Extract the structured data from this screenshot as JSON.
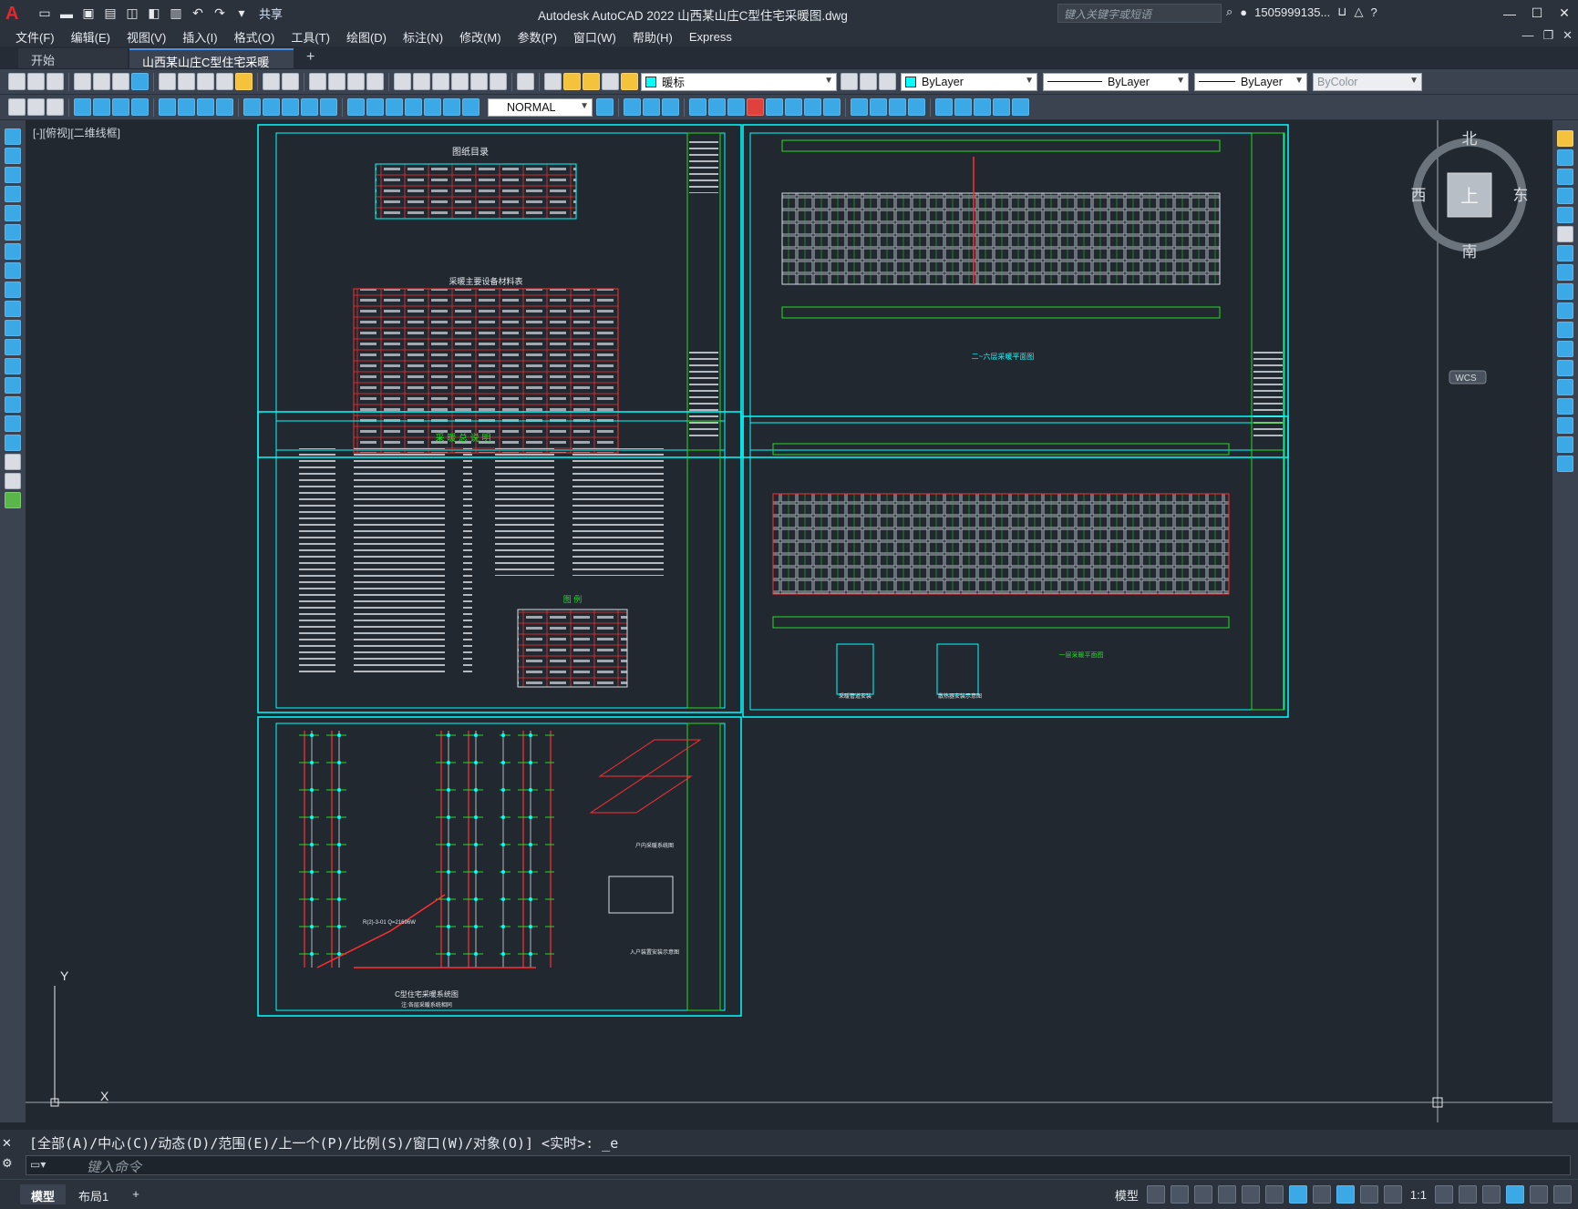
{
  "app": {
    "title": "Autodesk AutoCAD 2022    山西某山庄C型住宅采暖图.dwg",
    "share": "共享",
    "search_placeholder": "键入关键字或短语",
    "user": "1505999135...",
    "logo": "A"
  },
  "menu": [
    "文件(F)",
    "编辑(E)",
    "视图(V)",
    "插入(I)",
    "格式(O)",
    "工具(T)",
    "绘图(D)",
    "标注(N)",
    "修改(M)",
    "参数(P)",
    "窗口(W)",
    "帮助(H)",
    "Express"
  ],
  "tabs": {
    "start": "开始",
    "file": "山西某山庄C型住宅采暖图*",
    "close": "✕",
    "plus": "+"
  },
  "toolbar": {
    "layer": "暖标",
    "color": "ByLayer",
    "linetype": "ByLayer",
    "lineweight": "ByLayer",
    "plotstyle": "ByColor",
    "dimstyle": "NORMAL"
  },
  "view_label": "[-][俯视][二维线框]",
  "viewcube": {
    "north": "北",
    "south": "南",
    "east": "东",
    "west": "西",
    "top": "上",
    "wcs": "WCS"
  },
  "ucs": {
    "x": "X",
    "y": "Y"
  },
  "sheets": {
    "s1": {
      "title": "图纸目录",
      "table2_title": "采暖主要设备材料表",
      "list": [
        "暖施-00 图纸目录 采暖主要设备材料表",
        "暖施-01 采暖总说明 图例",
        "暖施-02 C型住宅采暖系统图",
        "暖施-03 一层采暖平面图",
        "暖施-04 二~六层采暖平面图"
      ]
    },
    "s2": {
      "title": "二~六层采暖平面图"
    },
    "s3": {
      "title": "采 暖 总 说 明",
      "legend": "图 例"
    },
    "s4": {
      "title": "一层采暖平面图",
      "sub1": "采暖管道安装",
      "sub2": "散热器安装示意图"
    },
    "s5": {
      "title": "C型住宅采暖系统图",
      "sub1": "户内采暖系统图",
      "sub2": "入户装置安装示意图",
      "note": "注:各层采暖系统相同",
      "label": "R(2)-3-01 Q=21696W"
    }
  },
  "command": {
    "history": "[全部(A)/中心(C)/动态(D)/范围(E)/上一个(P)/比例(S)/窗口(W)/对象(O)] <实时>: _e",
    "placeholder": "键入命令"
  },
  "status": {
    "model": "模型",
    "layout": "布局1",
    "plus": "+",
    "scale": "1:1"
  }
}
